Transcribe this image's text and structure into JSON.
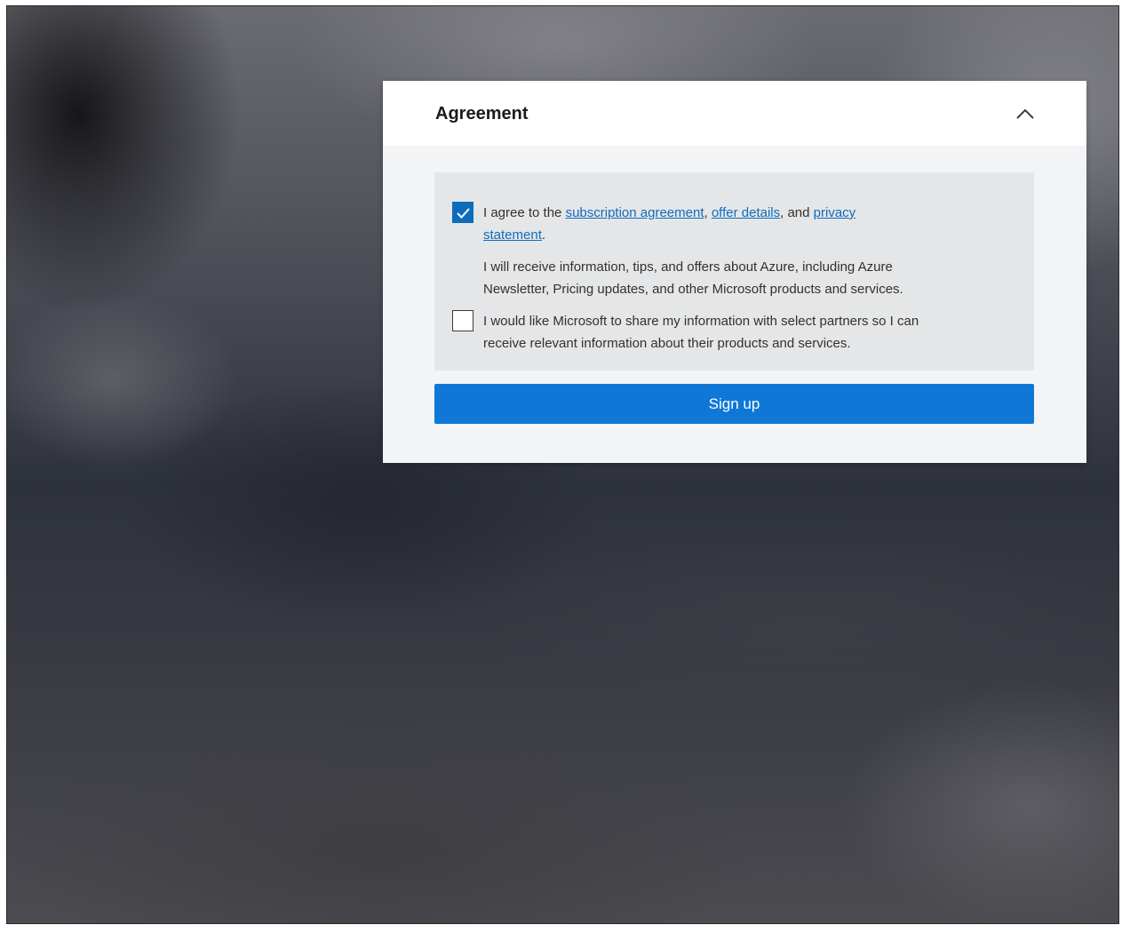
{
  "card": {
    "title": "Agreement",
    "collapse_icon": "chevron-up-icon"
  },
  "agreement": {
    "checked": true,
    "prefix": "I agree to the ",
    "link_subscription": "subscription agreement",
    "sep1": ", ",
    "link_offer": "offer details",
    "sep2": ", and ",
    "link_privacy_1": "privacy",
    "link_privacy_2": "statement",
    "suffix": "."
  },
  "info": {
    "line1": "I will receive information, tips, and offers about Azure, including Azure",
    "line2": "Newsletter, Pricing updates, and other Microsoft products and services."
  },
  "partners": {
    "checked": false,
    "line1": "I would like Microsoft to share my information with select partners so I can",
    "line2": "receive relevant information about their products and services."
  },
  "signup": {
    "label": "Sign up"
  },
  "colors": {
    "accent": "#0f78d7",
    "link": "#0f6cbd",
    "checkbox_checked": "#0f6cbd"
  }
}
